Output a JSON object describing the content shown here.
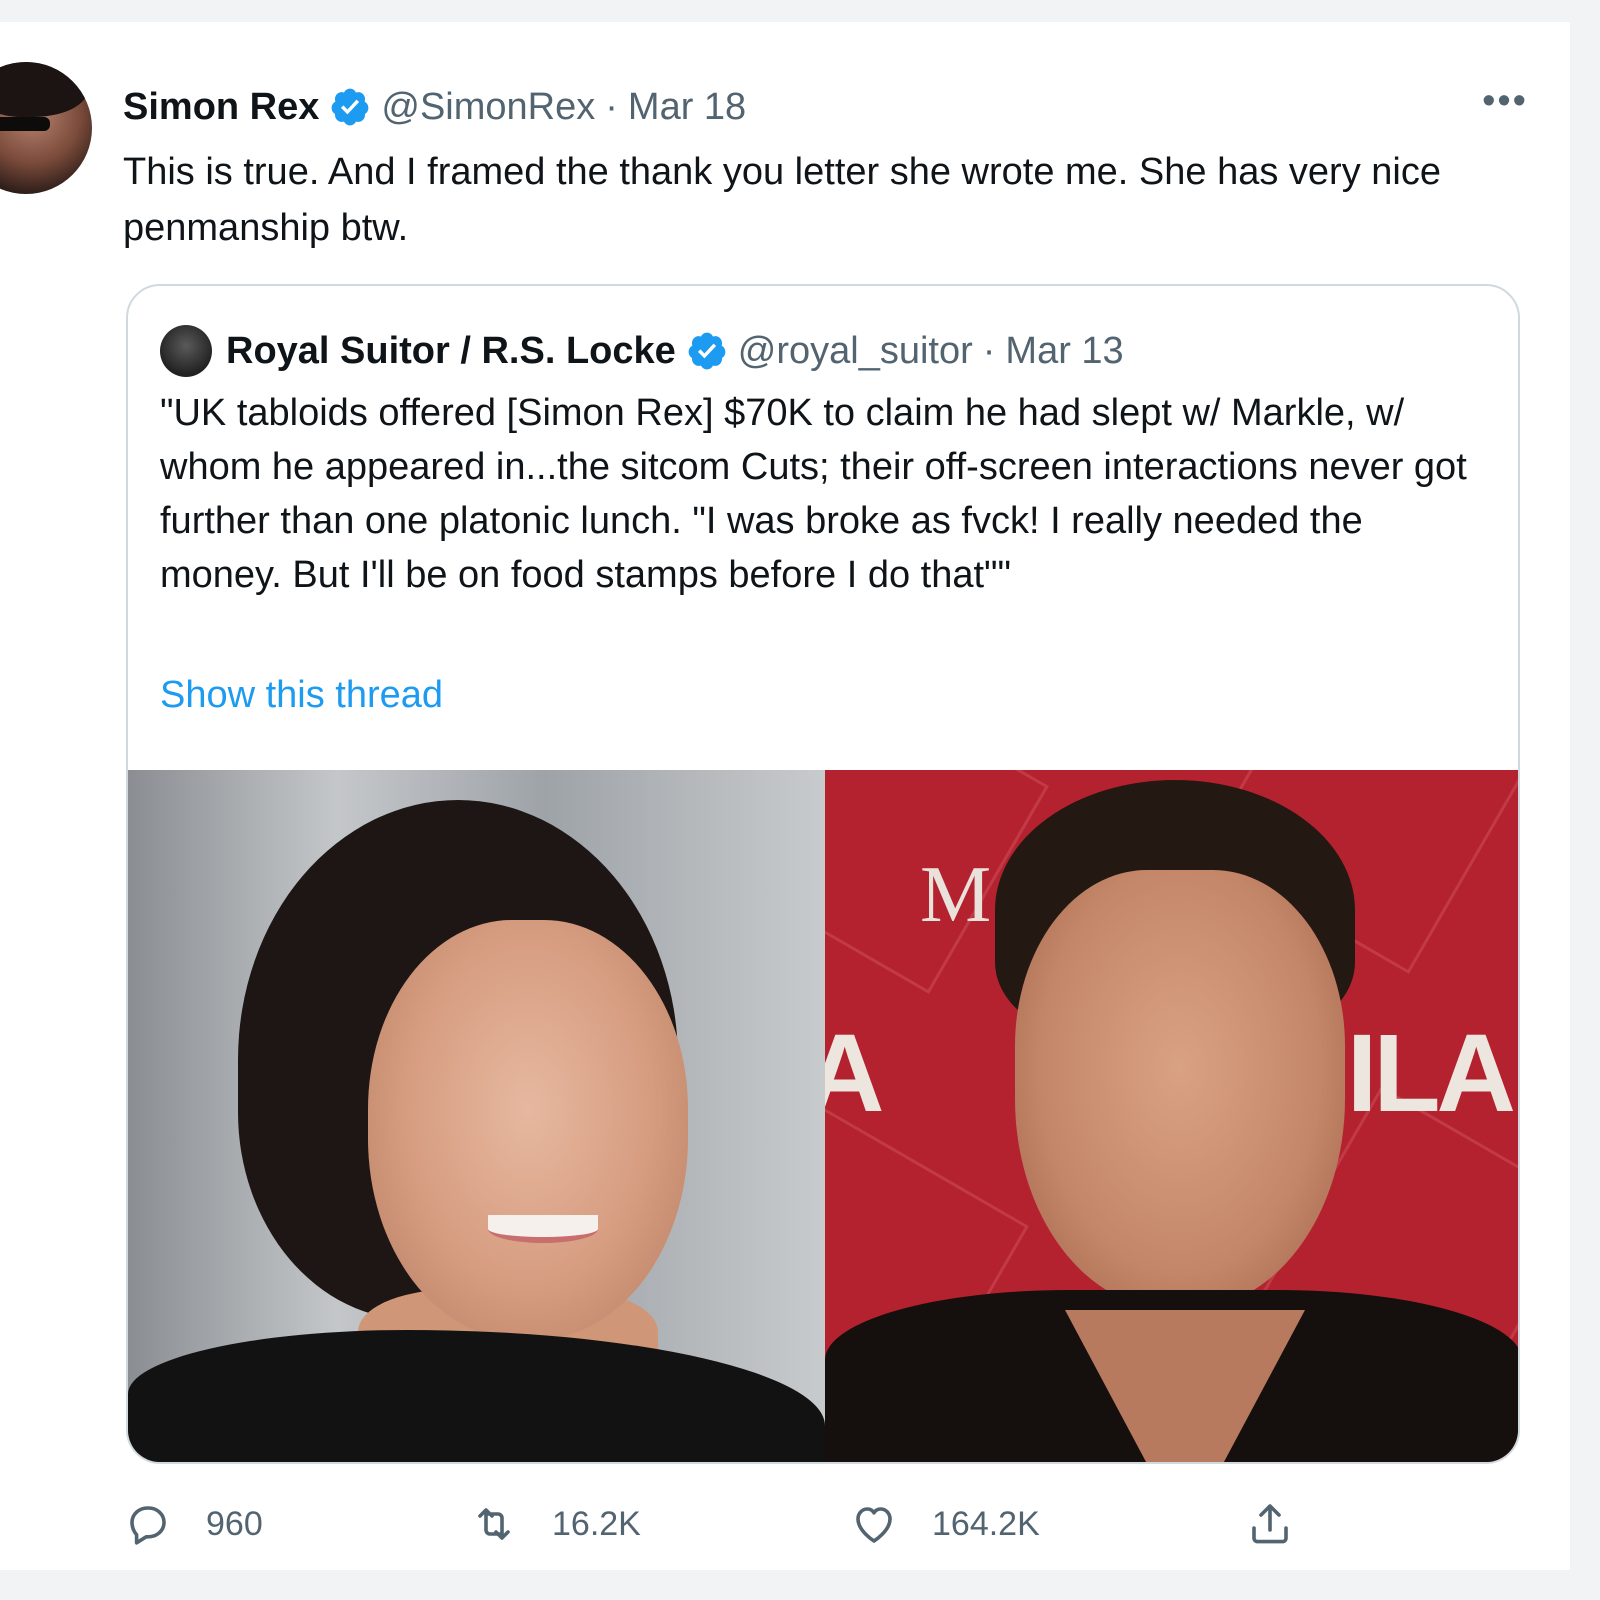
{
  "tweet": {
    "author_name": "Simon Rex",
    "handle": "@SimonRex",
    "separator": "·",
    "date": "Mar 18",
    "more": "•••",
    "text": "This is true. And I framed the thank you letter she wrote me. She has very nice penmanship btw."
  },
  "quote": {
    "author_name": "Royal Suitor / R.S. Locke",
    "handle": "@royal_suitor",
    "separator": "·",
    "date": "Mar 13",
    "text": "\"UK tabloids offered [Simon Rex] $70K to claim he had slept w/ Markle, w/ whom he appeared in...the sitcom Cuts; their off-screen interactions never got further than one platonic lunch. \"I was broke as fvck! I really needed the money. But I'll be on food stamps before I do that\"\"",
    "show_thread": "Show this thread",
    "media": {
      "right_sign_m": "M",
      "right_sign_fila": "ILA",
      "right_sign_left": "A"
    }
  },
  "actions": {
    "replies": "960",
    "retweets": "16.2K",
    "likes": "164.2K"
  },
  "colors": {
    "accent": "#1d9bf0",
    "secondary_text": "#536471",
    "border": "#cfd9de"
  },
  "icons": [
    "verified-badge-icon",
    "more-icon",
    "reply-icon",
    "retweet-icon",
    "like-icon",
    "share-icon"
  ]
}
